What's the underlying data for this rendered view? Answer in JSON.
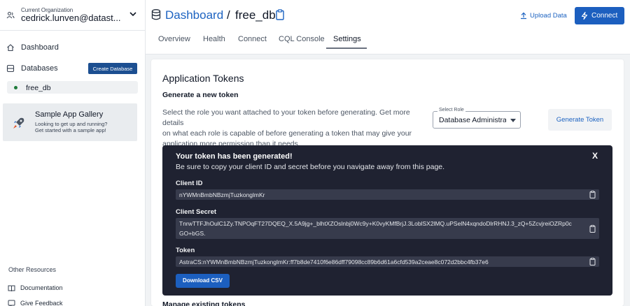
{
  "sidebar": {
    "org_label": "Current Organization",
    "org_name": "cedrick.lunven@datast...",
    "nav": {
      "dashboard": "Dashboard",
      "databases": "Databases",
      "create_database": "Create Database",
      "db_item": "free_db"
    },
    "gallery": {
      "title": "Sample App Gallery",
      "line1": "Looking to get up and running?",
      "line2": "Get started with a sample app!"
    },
    "other_resources": "Other Resources",
    "links": {
      "documentation": "Documentation",
      "feedback": "Give Feedback"
    }
  },
  "header": {
    "breadcrumb_root": "Dashboard",
    "breadcrumb_sep": "/",
    "breadcrumb_current": "free_db",
    "upload_label": "Upload Data",
    "connect_label": "Connect",
    "tabs": [
      "Overview",
      "Health",
      "Connect",
      "CQL Console",
      "Settings"
    ],
    "active_tab": "Settings"
  },
  "main": {
    "title": "Application Tokens",
    "subtitle": "Generate a new token",
    "desc_line1": "Select the role you want attached to your token before generating. Get more details",
    "desc_line2": "on what each role is capable of before generating a token that may give your",
    "desc_line3": "application more permission than it needs.",
    "role_label": "Select Role",
    "role_value": "Database Administrator",
    "generate_label": "Generate Token",
    "panel": {
      "title": "Your token has been generated!",
      "subtitle": "Be sure to copy your client ID and secret before you navigate away from this page.",
      "close": "X",
      "client_id_label": "Client ID",
      "client_id": "nYWMnBmbNBzmjTuzkonglmKr",
      "client_secret_label": "Client Secret",
      "client_secret_line1": "TnrwTTFJhOulC1Zy.TNPOqFT27DQEQ_X.5A9jg+_blhtXZOslnbj0Wc9y+K0vyKMfBrjJ.3LoblSX2lMQ.uPSelN4xqndoDlrRHNJ.3_zQ+5ZcvjreiOZRp0c",
      "client_secret_line2": "GO+bGS.",
      "token_label": "Token",
      "token": "AstraCS:nYWMnBmbNBzmjTuzkonglmKr:ff7b8de7410f6e86dff79098cc89b6d61a6cfd539a2ceae8c072d2bbc4fb37e6",
      "download_label": "Download CSV"
    },
    "manage_title": "Manage existing tokens"
  },
  "colors": {
    "accent": "#1c5fbf",
    "link": "#1d63c1",
    "panel_bg": "#1f2231",
    "status_dot": "#1e7a3a"
  }
}
